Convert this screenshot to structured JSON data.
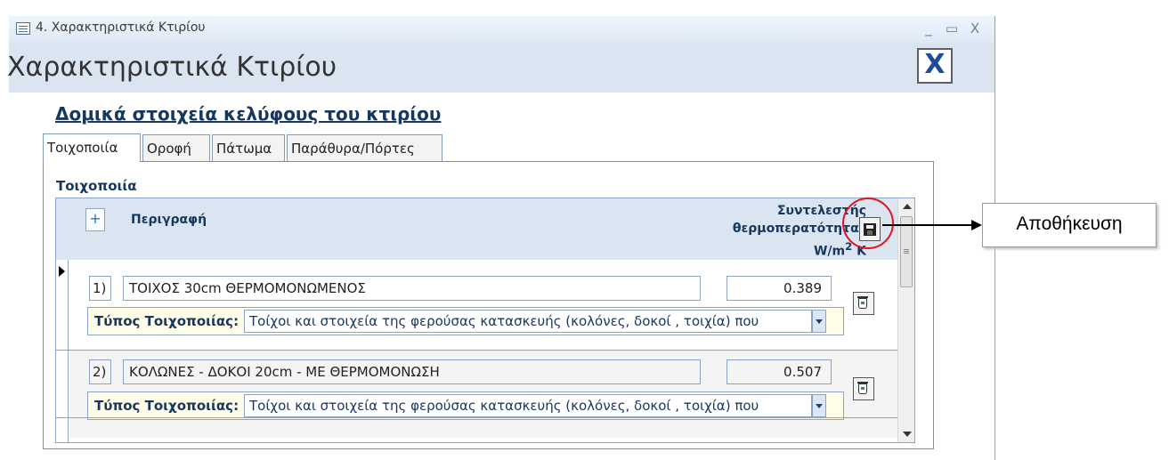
{
  "window": {
    "title": "4. Χαρακτηριστικά Κτιρίου",
    "minimize": "_",
    "maximize": "▭",
    "close": "X"
  },
  "form": {
    "title": "Χαρακτηριστικά Κτιρίου",
    "close_button": "X",
    "section_title": "Δομικά στοιχεία κελύφους του κτιρίου"
  },
  "tabs": [
    {
      "label": "Τοιχοποιία",
      "active": true
    },
    {
      "label": "Οροφή",
      "active": false
    },
    {
      "label": "Πάτωμα",
      "active": false
    },
    {
      "label": "Παράθυρα/Πόρτες",
      "active": false
    }
  ],
  "subform": {
    "title": "Τοιχοποιία",
    "add_button": "+",
    "header_description": "Περιγραφή",
    "header_coef_line1": "Συντελεστής",
    "header_coef_line2": "θερμοπερατότητας",
    "header_coef_unit": "W/m",
    "header_coef_unit_sup": "2",
    "header_coef_unit_k": " K",
    "type_label": "Τύπος Τοιχοποιίας:",
    "records": [
      {
        "index": "1)",
        "description": "ΤΟΙΧΟΣ 30cm ΘΕΡΜΟΜΟΝΩΜΕΝΟΣ",
        "u_value": "0.389",
        "wall_type": "Τοίχοι και στοιχεία της φερούσας κατασκευής (κολόνες, δοκοί , τοιχία) που"
      },
      {
        "index": "2)",
        "description": "ΚΟΛΩΝΕΣ - ΔΟΚΟΙ 20cm - ΜΕ ΘΕΡΜΟΜΟΝΩΣΗ",
        "u_value": "0.507",
        "wall_type": "Τοίχοι και στοιχεία της φερούσας κατασκευής (κολόνες, δοκοί , τοιχία) που"
      }
    ]
  },
  "callout": {
    "label": "Αποθήκευση",
    "color": "#e0141e"
  },
  "icons": {
    "save": "floppy-disk-icon",
    "delete": "recycle-bin-icon",
    "close": "close-x-icon"
  }
}
